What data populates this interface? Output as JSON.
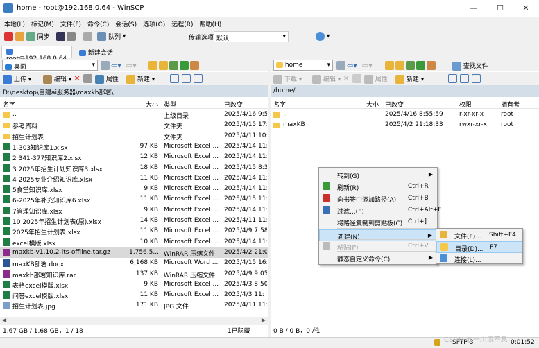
{
  "window": {
    "title": "home - root@192.168.0.64 - WinSCP",
    "min": "—",
    "max": "☐",
    "close": "✕"
  },
  "menubar": [
    "本地(L)",
    "标记(M)",
    "文件(F)",
    "命令(C)",
    "会话(S)",
    "选项(O)",
    "远程(R)",
    "帮助(H)"
  ],
  "toolbar1": {
    "sync": "同步",
    "queue": "队列",
    "transfer_label": "传输选项",
    "transfer_value": "默认"
  },
  "sessions": {
    "current": "root@192.168.0.64",
    "new": "新建会话"
  },
  "left": {
    "drive": "桌面",
    "upload": "上传",
    "edit": "编辑",
    "props": "属性",
    "new": "新建",
    "path": "D:\\desktop\\自建ai服务器\\maxkb部署\\",
    "headers": {
      "name": "名字",
      "size": "大小",
      "type": "类型",
      "changed": "已改变"
    },
    "files": [
      {
        "icon": "up",
        "name": "..",
        "size": "",
        "type": "上级目录",
        "changed": "2025/4/16  9:5"
      },
      {
        "icon": "folder",
        "name": "参考资料",
        "size": "",
        "type": "文件夹",
        "changed": "2025/4/15  17:"
      },
      {
        "icon": "folder",
        "name": "招生计划表",
        "size": "",
        "type": "文件夹",
        "changed": "2025/4/11  10:"
      },
      {
        "icon": "xls",
        "name": "1-303知识库1.xlsx",
        "size": "97 KB",
        "type": "Microsoft Excel ...",
        "changed": "2025/4/14  11:"
      },
      {
        "icon": "xls",
        "name": "2 341-377知识库2.xlsx",
        "size": "12 KB",
        "type": "Microsoft Excel ...",
        "changed": "2025/4/14  11:"
      },
      {
        "icon": "xls",
        "name": "3 2025年招生计划知识库3.xlsx",
        "size": "18 KB",
        "type": "Microsoft Excel ...",
        "changed": "2025/4/15  8:3"
      },
      {
        "icon": "xls",
        "name": "4 2025专业介绍知识库.xlsx",
        "size": "11 KB",
        "type": "Microsoft Excel ...",
        "changed": "2025/4/14  11:"
      },
      {
        "icon": "xls",
        "name": "5食堂知识库.xlsx",
        "size": "9 KB",
        "type": "Microsoft Excel ...",
        "changed": "2025/4/14  11:"
      },
      {
        "icon": "xls",
        "name": "6-2025年补充知识库6.xlsx",
        "size": "11 KB",
        "type": "Microsoft Excel ...",
        "changed": "2025/4/15  11:"
      },
      {
        "icon": "xls",
        "name": "7管理知识库.xlsx",
        "size": "9 KB",
        "type": "Microsoft Excel ...",
        "changed": "2025/4/14  11:"
      },
      {
        "icon": "xls",
        "name": "10 2025年招生计划表(原).xlsx",
        "size": "14 KB",
        "type": "Microsoft Excel ...",
        "changed": "2025/4/11  11:"
      },
      {
        "icon": "xls",
        "name": "2025年招生计划表.xlsx",
        "size": "11 KB",
        "type": "Microsoft Excel ...",
        "changed": "2025/4/9  7:58"
      },
      {
        "icon": "xls",
        "name": "excel模版.xlsx",
        "size": "10 KB",
        "type": "Microsoft Excel ...",
        "changed": "2025/4/14  11:"
      },
      {
        "icon": "rar",
        "name": "maxkb-v1.10.2-lts-offline.tar.gz",
        "size": "1,756,5...",
        "type": "WinRAR 压缩文件",
        "changed": "2025/4/2  21:0",
        "selected": true
      },
      {
        "icon": "doc",
        "name": "maxKB部署.docx",
        "size": "6,168 KB",
        "type": "Microsoft Word ...",
        "changed": "2025/4/15  16:"
      },
      {
        "icon": "rar",
        "name": "maxkb部署知识库.rar",
        "size": "137 KB",
        "type": "WinRAR 压缩文件",
        "changed": "2025/4/9  9:05"
      },
      {
        "icon": "xls",
        "name": "表格excel模版.xlsx",
        "size": "9 KB",
        "type": "Microsoft Excel ...",
        "changed": "2025/4/3  8:50"
      },
      {
        "icon": "xls",
        "name": "问答excel模版.xlsx",
        "size": "11 KB",
        "type": "Microsoft Excel ...",
        "changed": "2025/4/3  11:"
      },
      {
        "icon": "jpg",
        "name": "招生计划表.jpg",
        "size": "171 KB",
        "type": "JPG 文件",
        "changed": "2025/4/11  11:"
      }
    ],
    "status": "1.67 GB / 1.68 GB，1 / 18"
  },
  "right": {
    "drive": "home",
    "download": "下载",
    "edit": "编辑",
    "props": "属性",
    "new": "新建",
    "find": "查找文件",
    "path": "/home/",
    "headers": {
      "name": "名字",
      "size": "大小",
      "changed": "已改变",
      "rights": "权限",
      "owner": "拥有者"
    },
    "files": [
      {
        "icon": "up",
        "name": "..",
        "size": "",
        "changed": "2025/4/16  8:55:59",
        "rights": "r-xr-xr-x",
        "owner": "root"
      },
      {
        "icon": "folder",
        "name": "maxKB",
        "size": "",
        "changed": "2025/4/2  21:18:33",
        "rights": "rwxr-xr-x",
        "owner": "root"
      }
    ],
    "status": "0 B / 0 B，0 / 1"
  },
  "hidden_status": "1已隐藏",
  "bottom": {
    "protocol": "SFTP-3",
    "time": "0:01:52",
    "watermark": "CSDN @一川流不息"
  },
  "context_menu": [
    {
      "label": "转到(G)",
      "shortcut": "",
      "arrow": true
    },
    {
      "label": "刷新(R)",
      "shortcut": "Ctrl+R",
      "icon": "refresh"
    },
    {
      "label": "向书签中添加路径(A)",
      "shortcut": "Ctrl+B",
      "icon": "bookmark"
    },
    {
      "label": "过滤...(F)",
      "shortcut": "Ctrl+Alt+F",
      "icon": "filter"
    },
    {
      "label": "将路径复制到剪贴板(C)",
      "shortcut": "Ctrl+]"
    },
    {
      "label": "新建(N)",
      "shortcut": "",
      "arrow": true,
      "highlight": true
    },
    {
      "label": "粘贴(P)",
      "shortcut": "Ctrl+V",
      "disabled": true,
      "icon": "paste"
    },
    {
      "label": "静态自定义命令(C)",
      "shortcut": "",
      "arrow": true
    }
  ],
  "submenu": [
    {
      "label": "文件(F)...",
      "shortcut": "Shift+F4",
      "icon": "file"
    },
    {
      "label": "目录(D)...",
      "shortcut": "F7",
      "icon": "folder",
      "highlight": true
    },
    {
      "label": "连接(L)...",
      "shortcut": "",
      "icon": "link"
    }
  ]
}
